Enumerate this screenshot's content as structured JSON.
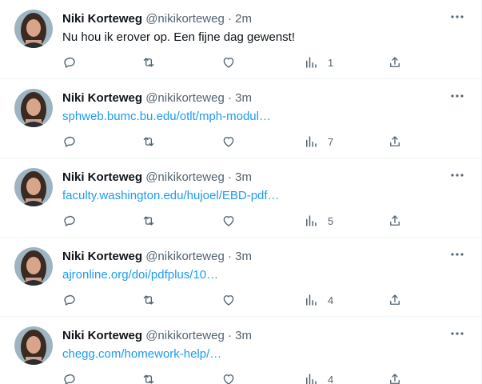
{
  "tweets": [
    {
      "name": "Niki Korteweg",
      "handle": "@nikikorteweg",
      "separator": "·",
      "time": "2m",
      "text": "Nu hou ik erover op. Een fijne dag gewenst!",
      "is_link": false,
      "views": "1"
    },
    {
      "name": "Niki Korteweg",
      "handle": "@nikikorteweg",
      "separator": "·",
      "time": "3m",
      "text": "sphweb.bumc.bu.edu/otlt/mph-modul…",
      "is_link": true,
      "views": "7"
    },
    {
      "name": "Niki Korteweg",
      "handle": "@nikikorteweg",
      "separator": "·",
      "time": "3m",
      "text": "faculty.washington.edu/hujoel/EBD-pdf…",
      "is_link": true,
      "views": "5"
    },
    {
      "name": "Niki Korteweg",
      "handle": "@nikikorteweg",
      "separator": "·",
      "time": "3m",
      "text": "ajronline.org/doi/pdfplus/10…",
      "is_link": true,
      "views": "4"
    },
    {
      "name": "Niki Korteweg",
      "handle": "@nikikorteweg",
      "separator": "·",
      "time": "3m",
      "text": "chegg.com/homework-help/…",
      "is_link": true,
      "views": "4"
    }
  ],
  "icons": {
    "more": "more-horizontal-icon",
    "reply": "reply-icon",
    "retweet": "retweet-icon",
    "like": "heart-icon",
    "views": "views-icon",
    "share": "share-icon"
  },
  "colors": {
    "link": "#1d9bf0",
    "secondary": "#536471",
    "text": "#0f1419",
    "border": "#eff3f4"
  }
}
